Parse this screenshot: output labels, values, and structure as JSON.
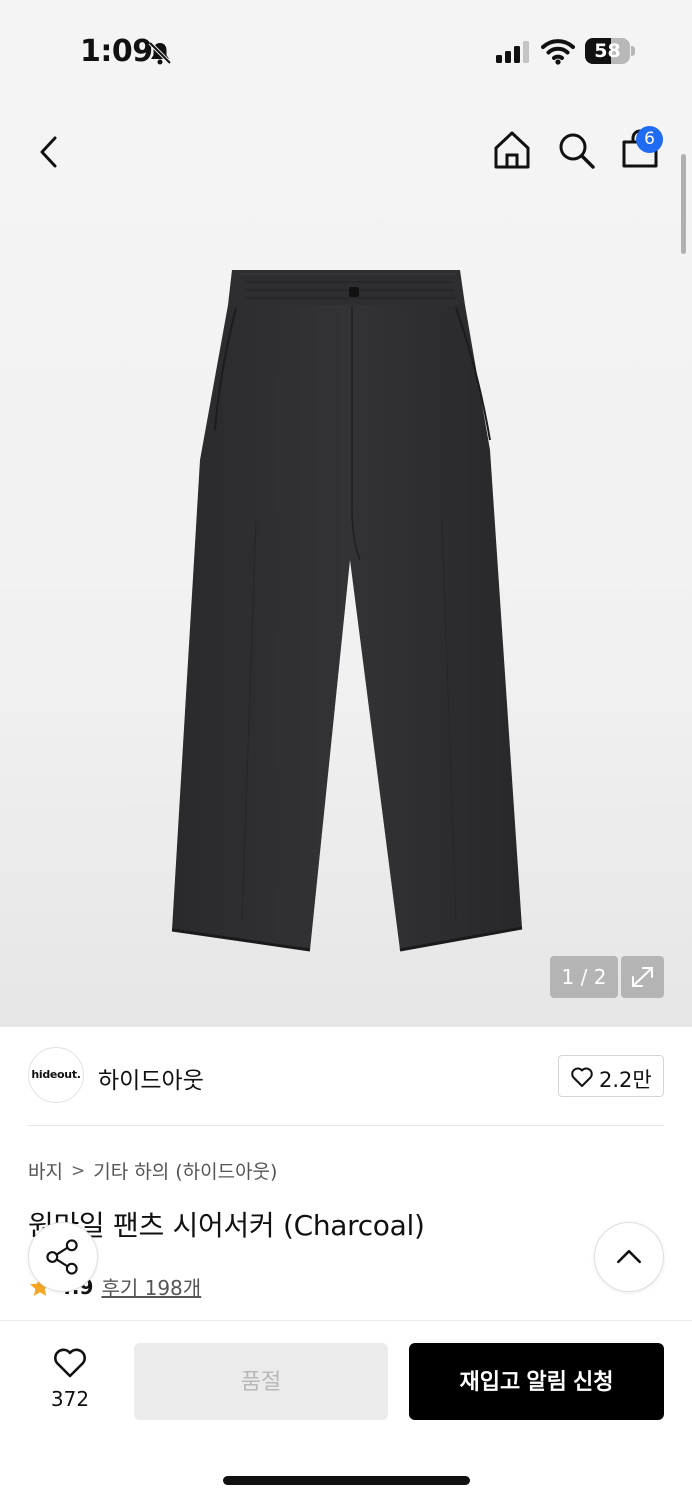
{
  "status_bar": {
    "time": "1:09",
    "battery": "58",
    "battery_level": 0.58
  },
  "header": {
    "back_icon": "chevron-left-icon",
    "home_icon": "home-icon",
    "search_icon": "search-icon",
    "cart_icon": "shopping-bag-icon",
    "cart_badge": "6",
    "badge_color": "#1f6bf2"
  },
  "gallery": {
    "counter": "1 / 2",
    "product_color": "#2b2b2d"
  },
  "brand": {
    "logo_text": "hideout.",
    "name": "하이드아웃",
    "like_count": "2.2만"
  },
  "breadcrumb": {
    "category": "바지",
    "subcategory": "기타 하의 (하이드아웃)"
  },
  "product": {
    "title": "원마일 팬츠 시어서커 (Charcoal)",
    "rating": "4.9",
    "reviews": "후기 198개",
    "star_color": "#f5a623"
  },
  "bottom_bar": {
    "wish_count": "372",
    "soldout_label": "품절",
    "restock_label": "재입고 알림 신청"
  }
}
